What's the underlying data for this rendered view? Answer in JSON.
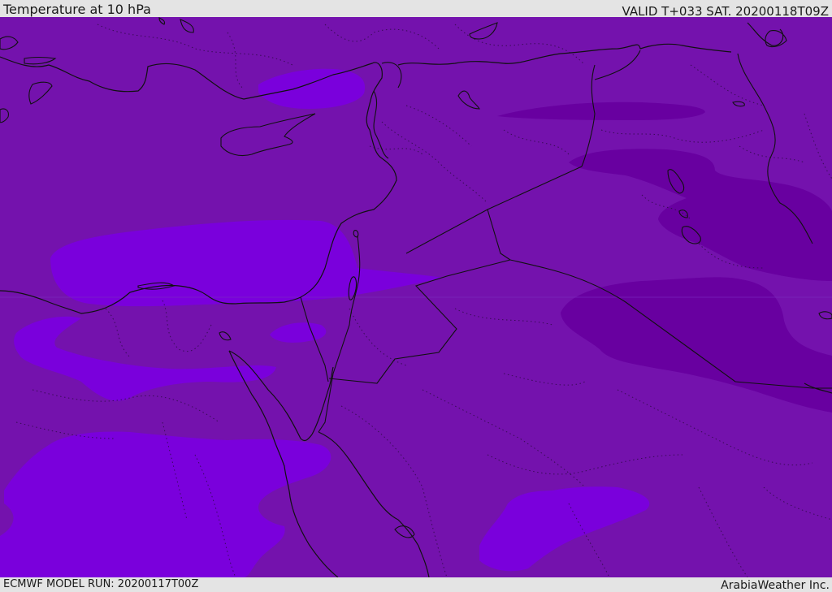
{
  "header": {
    "title": "Temperature at 10 hPa",
    "valid_time": "VALID T+033 SAT. 20200118T09Z"
  },
  "footer": {
    "model_run": "ECMWF MODEL RUN: 20200117T00Z",
    "credit": "ArabiaWeather Inc."
  },
  "map": {
    "colors": {
      "base": "#7412ad",
      "warm": "#7a00dc",
      "cold": "#6800a0",
      "coast": "#111111",
      "border": "#111111"
    }
  }
}
